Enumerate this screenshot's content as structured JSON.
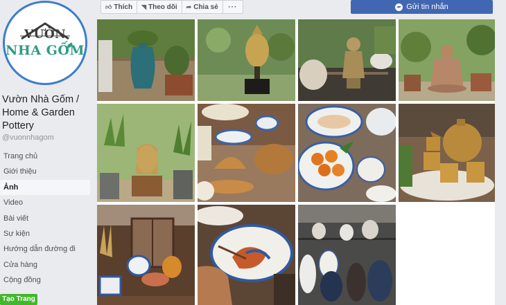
{
  "page": {
    "logo": {
      "line1": "VƯỜN",
      "line2": "NHA GỐM"
    },
    "name": "Vườn Nhà Gốm / Home & Garden Pottery",
    "handle": "@vuonnhagom",
    "nav": [
      {
        "label": "Trang chủ"
      },
      {
        "label": "Giới thiệu"
      },
      {
        "label": "Ảnh",
        "active": true
      },
      {
        "label": "Video"
      },
      {
        "label": "Bài viết"
      },
      {
        "label": "Sự kiện"
      },
      {
        "label": "Hướng dẫn đường đi"
      },
      {
        "label": "Cửa hàng"
      },
      {
        "label": "Cộng đồng"
      }
    ],
    "create_page": "Tạo Trang"
  },
  "actions": {
    "like": "Thích",
    "follow": "Theo dõi",
    "share": "Chia sẻ",
    "more": "···",
    "message": "Gửi tin nhắn"
  },
  "colors": {
    "accent": "#4267b2",
    "create": "#42b72a",
    "logo_green": "#2f9c83",
    "ring": "#3c7ccf"
  },
  "icons": {
    "like": "thumbs-up-icon",
    "follow": "rss-icon",
    "share": "share-arrow-icon",
    "message": "messenger-icon"
  },
  "photos": [
    {
      "subject": "garden-vase"
    },
    {
      "subject": "buddha-head-bronze"
    },
    {
      "subject": "monk-statue-table"
    },
    {
      "subject": "buddha-statue-garden"
    },
    {
      "subject": "buddha-head-plants"
    },
    {
      "subject": "teapot-set-blue"
    },
    {
      "subject": "fruit-plates"
    },
    {
      "subject": "tea-set-amber"
    },
    {
      "subject": "pottery-shelf"
    },
    {
      "subject": "hand-painting-plate"
    },
    {
      "subject": "vase-collection"
    }
  ]
}
